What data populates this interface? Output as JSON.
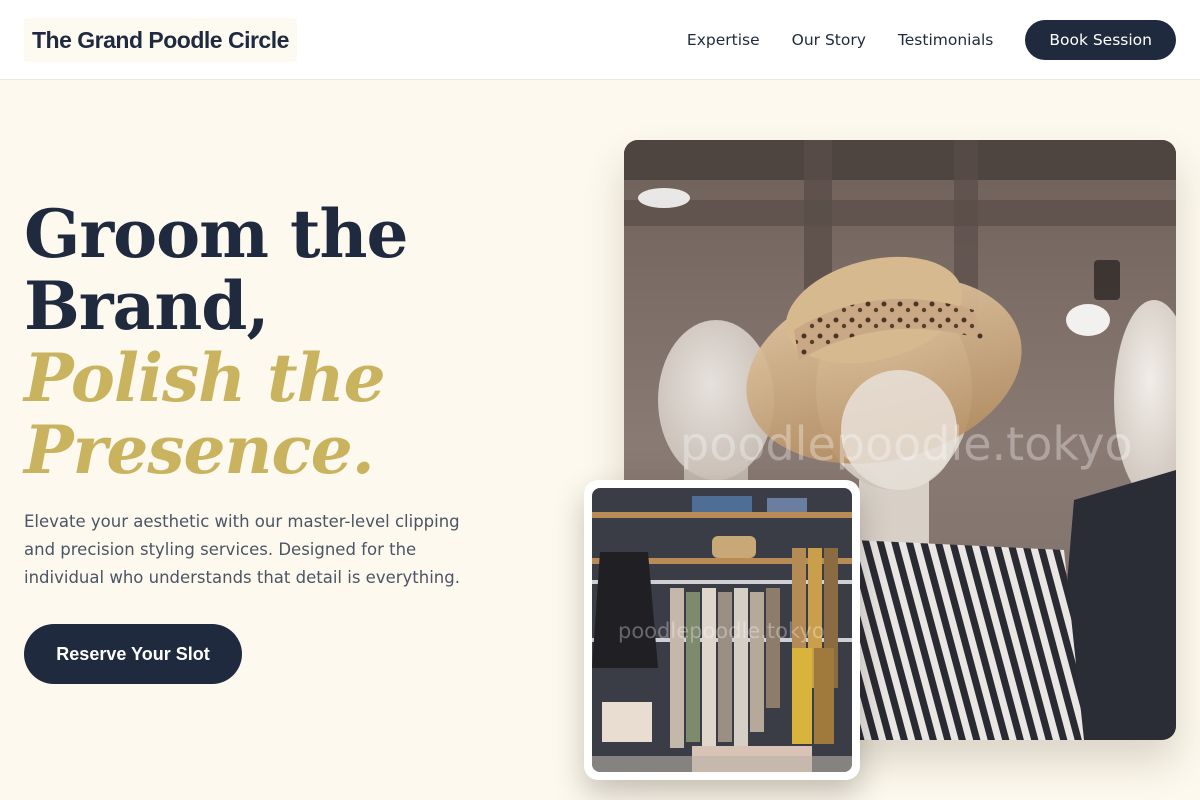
{
  "header": {
    "logo": "The Grand Poodle Circle",
    "nav": [
      "Expertise",
      "Our Story",
      "Testimonials"
    ],
    "cta": "Book Session"
  },
  "hero": {
    "headline_line1": "Groom the",
    "headline_line2": "Brand,",
    "headline_line3": "Polish the",
    "headline_line4": "Presence.",
    "intro_line1": "Elevate your aesthetic with our master-level clipping",
    "intro_line2": "and precision styling services. Designed for the",
    "intro_line3": "individual who understands that detail is everything.",
    "cta": "Reserve Your Slot"
  },
  "images": {
    "main_watermark": "poodlepoodle.tokyo",
    "inset_watermark": "poodlepoodle.tokyo"
  },
  "colors": {
    "navy": "#1f2a3f",
    "gold": "#c9b35e",
    "cream": "#fdf9ee"
  }
}
